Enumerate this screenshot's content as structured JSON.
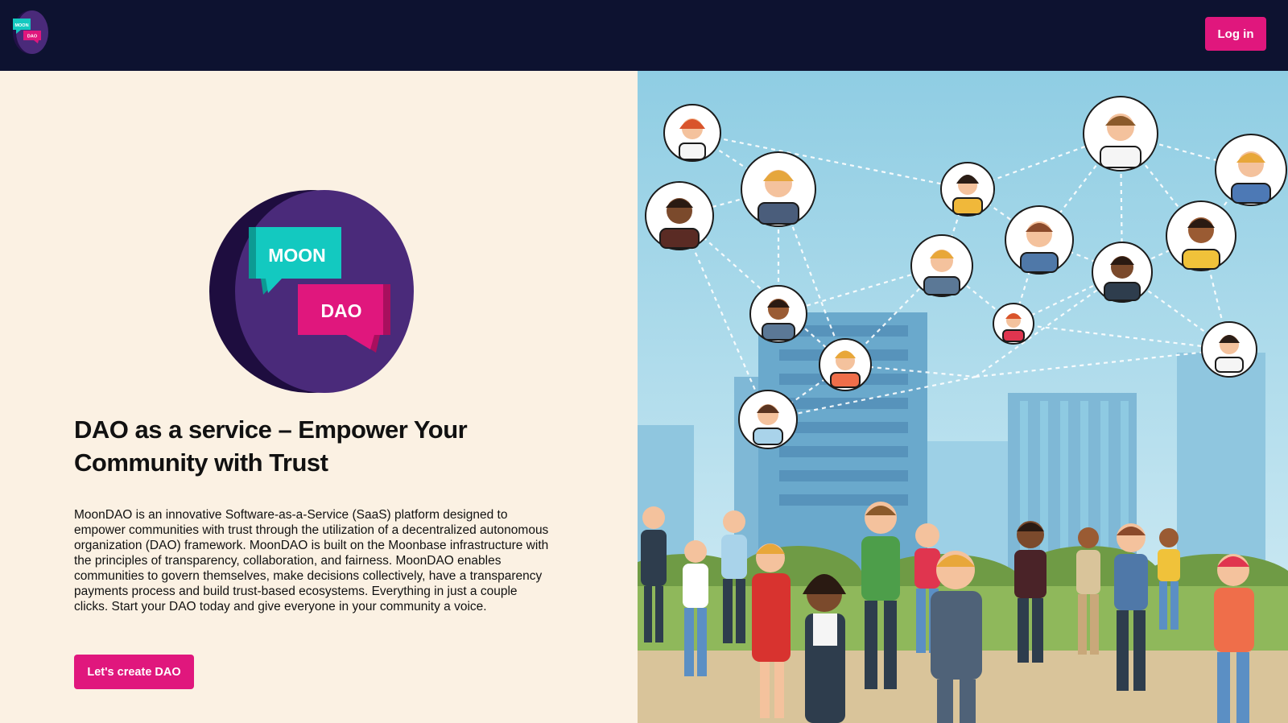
{
  "header": {
    "logo_text_top": "MOON",
    "logo_text_bottom": "DAO",
    "login_label": "Log in"
  },
  "hero": {
    "logo_text_top": "MOON",
    "logo_text_bottom": "DAO",
    "title": "DAO as a service – Empower Your Community with Trust",
    "description": "MoonDAO is an innovative Software-as-a-Service (SaaS) platform designed to empower communities with trust through the utilization of a decentralized autonomous organization (DAO) framework. MoonDAO is built on the Moonbase infrastructure with the principles of transparency, collaboration, and fairness. MoonDAO enables communities to govern themselves, make decisions collectively, have a transparency payments process and build trust-based ecosystems. Everything in just a couple clicks. Start your DAO today and give everyone in your community a voice.",
    "cta_label": "Let's create DAO"
  },
  "illustration": {
    "icon": "community-network-illustration"
  },
  "colors": {
    "header_bg": "#0d1230",
    "accent": "#e0177d",
    "page_bg": "#fbf1e3",
    "logo_purple": "#4a2a7a",
    "logo_teal": "#13c9c0",
    "sky": "#a9d9ea"
  }
}
